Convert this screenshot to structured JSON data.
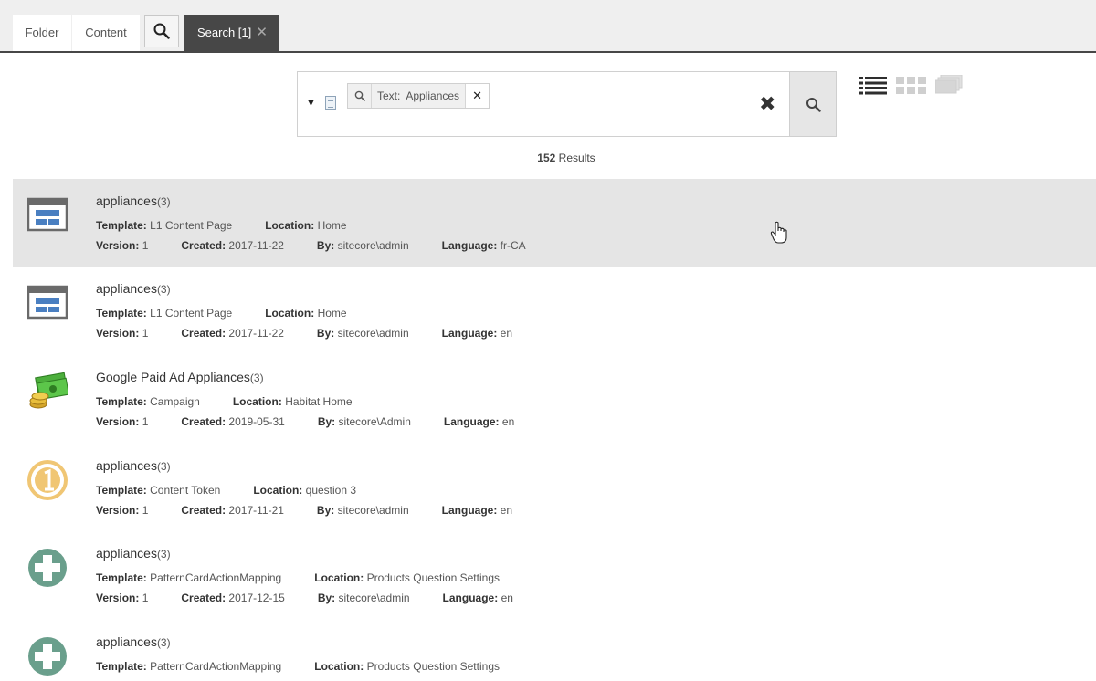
{
  "tabs": {
    "folder": "Folder",
    "content": "Content",
    "search": "Search [1]",
    "search_close": "✕"
  },
  "search": {
    "chip_label": "Text:",
    "chip_value": "Appliances",
    "chip_remove": "✕",
    "clear": "✖"
  },
  "results_count": {
    "number": "152",
    "label": "Results"
  },
  "meta_labels": {
    "template": "Template:",
    "location": "Location:",
    "version": "Version:",
    "created": "Created:",
    "by": "By:",
    "language": "Language:"
  },
  "results": [
    {
      "icon": "page-layout-icon",
      "title": "appliances",
      "count": "(3)",
      "template": "L1 Content Page",
      "location": "Home",
      "version": "1",
      "created": "2017-11-22",
      "by": "sitecore\\admin",
      "language": "fr-CA"
    },
    {
      "icon": "page-layout-icon",
      "title": "appliances",
      "count": "(3)",
      "template": "L1 Content Page",
      "location": "Home",
      "version": "1",
      "created": "2017-11-22",
      "by": "sitecore\\admin",
      "language": "en"
    },
    {
      "icon": "money-coins-icon",
      "title": "Google Paid Ad Appliances",
      "count": "(3)",
      "template": "Campaign",
      "location": "Habitat Home",
      "version": "1",
      "created": "2019-05-31",
      "by": "sitecore\\Admin",
      "language": "en"
    },
    {
      "icon": "token-coin-icon",
      "title": "appliances",
      "count": "(3)",
      "template": "Content Token",
      "location": "question 3",
      "version": "1",
      "created": "2017-11-21",
      "by": "sitecore\\admin",
      "language": "en"
    },
    {
      "icon": "plus-circle-icon",
      "title": "appliances",
      "count": "(3)",
      "template": "PatternCardActionMapping",
      "location": "Products Question Settings",
      "version": "1",
      "created": "2017-12-15",
      "by": "sitecore\\admin",
      "language": "en"
    },
    {
      "icon": "plus-circle-icon",
      "title": "appliances",
      "count": "(3)",
      "template": "PatternCardActionMapping",
      "location": "Products Question Settings"
    }
  ],
  "colors": {
    "active_tab": "#474747",
    "hover_row": "#e5e5e5",
    "plus_icon": "#6a9f8c",
    "token_icon": "#f0c674"
  }
}
